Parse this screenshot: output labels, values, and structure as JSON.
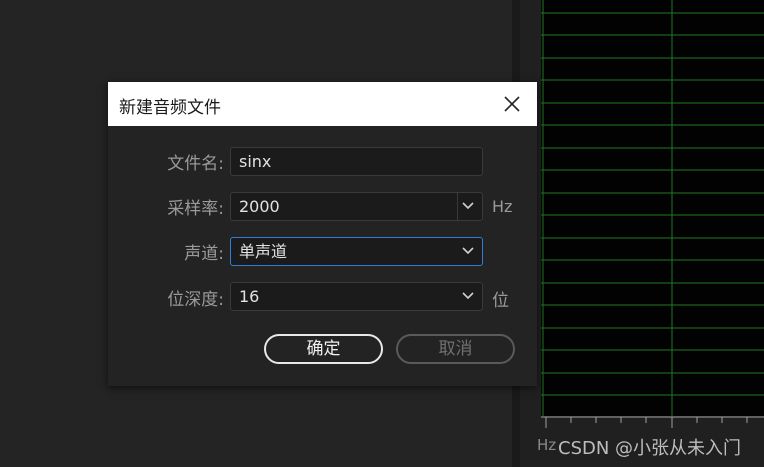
{
  "dialog": {
    "title": "新建音频文件",
    "filename_label": "文件名:",
    "filename_value": "sinx",
    "samplerate_label": "采样率:",
    "samplerate_value": "2000",
    "samplerate_unit": "Hz",
    "channel_label": "声道:",
    "channel_value": "单声道",
    "bitdepth_label": "位深度:",
    "bitdepth_value": "16",
    "bitdepth_unit": "位",
    "ok_label": "确定",
    "cancel_label": "取消"
  },
  "spectrum": {
    "axis_unit": "Hz",
    "grid_color": "#1f7a1f"
  },
  "watermark": "CSDN @小张从未入门",
  "colors": {
    "accent": "#2f7ed8",
    "dialog_bg": "#232323",
    "header_bg": "#ffffff"
  }
}
